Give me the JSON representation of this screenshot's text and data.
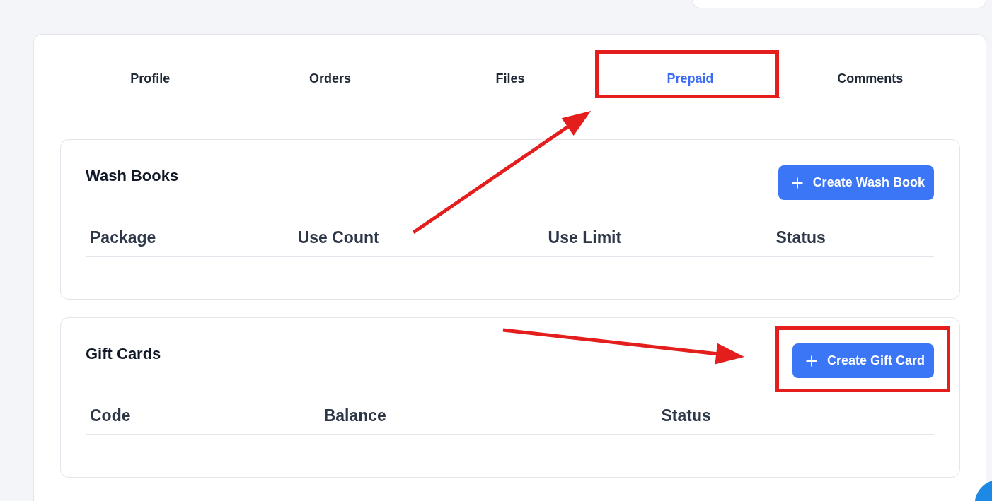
{
  "tabs": [
    {
      "label": "Profile",
      "selected": false,
      "highlighted": false
    },
    {
      "label": "Orders",
      "selected": false,
      "highlighted": false
    },
    {
      "label": "Files",
      "selected": false,
      "highlighted": false
    },
    {
      "label": "Prepaid",
      "selected": true,
      "highlighted": true
    },
    {
      "label": "Comments",
      "selected": false,
      "highlighted": false
    }
  ],
  "sections": [
    {
      "title": "Wash Books",
      "button": {
        "label": "Create Wash Book",
        "highlighted": false
      },
      "table": {
        "columns": [
          "Package",
          "Use Count",
          "Use Limit",
          "Status"
        ]
      }
    },
    {
      "title": "Gift Cards",
      "button": {
        "label": "Create Gift Card",
        "highlighted": true
      },
      "table": {
        "columns": [
          "Code",
          "Balance",
          "Status"
        ]
      }
    }
  ]
}
